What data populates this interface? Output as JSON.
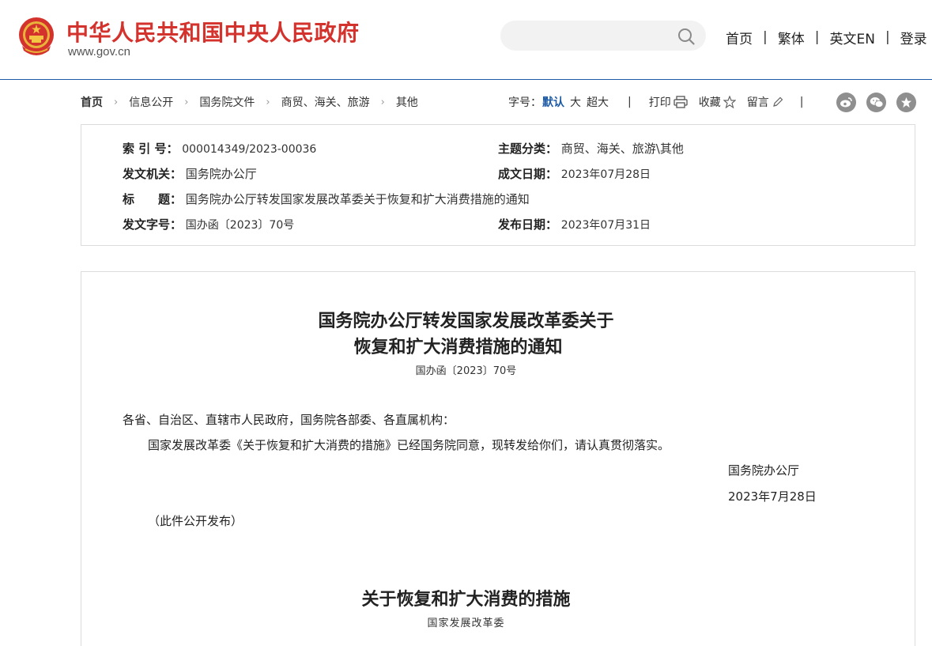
{
  "header": {
    "site_name": "中华人民共和国中央人民政府",
    "site_url": "www.gov.cn",
    "search_placeholder": "",
    "nav": [
      "首页",
      "繁体",
      "英文EN",
      "登录"
    ],
    "nav_separator": "|"
  },
  "breadcrumb": {
    "items": [
      "首页",
      "信息公开",
      "国务院文件",
      "商贸、海关、旅游",
      "其他"
    ],
    "arrow": "›"
  },
  "tools": {
    "font_label": "字号：",
    "font_default": "默认",
    "font_large": "大",
    "font_xlarge": "超大",
    "separator": "|",
    "print": "打印",
    "favorite": "收藏",
    "comment": "留言"
  },
  "social_icons": [
    "weibo-icon",
    "wechat-icon",
    "favorite-star-icon"
  ],
  "info": {
    "index_label": "索 引 号：",
    "index_value": "000014349/2023-00036",
    "topic_label": "主题分类：",
    "topic_value": "商贸、海关、旅游\\其他",
    "issuer_label": "发文机关：",
    "issuer_value": "国务院办公厅",
    "created_label": "成文日期：",
    "created_value": "2023年07月28日",
    "title_label": "标　　题：",
    "title_value": "国务院办公厅转发国家发展改革委关于恢复和扩大消费措施的通知",
    "docno_label": "发文字号：",
    "docno_value": "国办函〔2023〕70号",
    "published_label": "发布日期：",
    "published_value": "2023年07月31日"
  },
  "document": {
    "title_line1": "国务院办公厅转发国家发展改革委关于",
    "title_line2": "恢复和扩大消费措施的通知",
    "doc_number": "国办函〔2023〕70号",
    "salutation": "各省、自治区、直辖市人民政府，国务院各部委、各直属机构：",
    "body": "国家发展改革委《关于恢复和扩大消费的措施》已经国务院同意，现转发给你们，请认真贯彻落实。",
    "signature_org": "国务院办公厅",
    "signature_date": "2023年7月28日",
    "public_note": "（此件公开发布）",
    "attachment_title": "关于恢复和扩大消费的措施",
    "attachment_issuer": "国家发展改革委"
  },
  "colors": {
    "brand_red": "#d4322c",
    "link_blue": "#1c5aa6",
    "icon_gray": "#8f8f8f"
  }
}
